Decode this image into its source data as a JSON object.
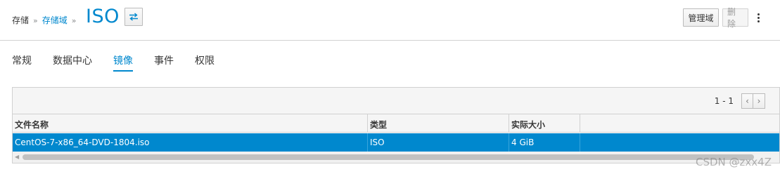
{
  "breadcrumb": {
    "root": "存储",
    "sep1": "»",
    "link": "存储域",
    "sep2": "»"
  },
  "title": "ISO",
  "actions": {
    "manage": "管理域",
    "delete": "删除"
  },
  "tabs": [
    {
      "label": "常规",
      "active": false
    },
    {
      "label": "数据中心",
      "active": false
    },
    {
      "label": "镜像",
      "active": true
    },
    {
      "label": "事件",
      "active": false
    },
    {
      "label": "权限",
      "active": false
    }
  ],
  "pagination": {
    "range": "1 - 1",
    "prev": "‹",
    "next": "›"
  },
  "table": {
    "columns": [
      "文件名称",
      "类型",
      "实际大小",
      ""
    ],
    "rows": [
      {
        "name": "CentOS-7-x86_64-DVD-1804.iso",
        "type": "ISO",
        "size": "4 GiB",
        "extra": "",
        "selected": true
      }
    ]
  },
  "watermark": "CSDN @zxx4Z",
  "colors": {
    "accent": "#0088ce",
    "selected_row": "#0088ce"
  }
}
